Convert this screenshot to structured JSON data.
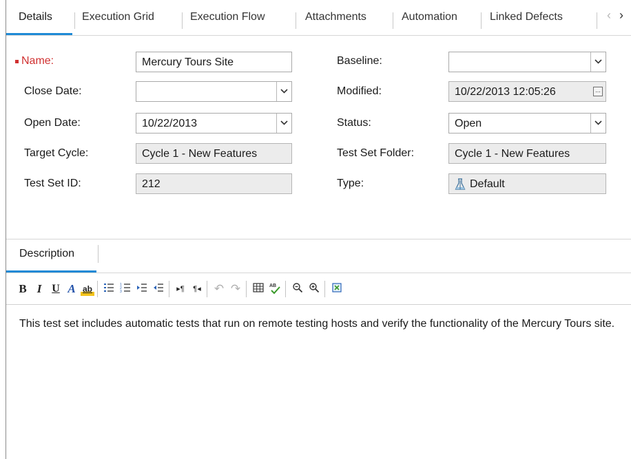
{
  "tabs": {
    "items": [
      "Details",
      "Execution Grid",
      "Execution Flow",
      "Attachments",
      "Automation",
      "Linked Defects"
    ],
    "active": "Details"
  },
  "form": {
    "name_label": "Name:",
    "name_value": "Mercury Tours Site",
    "close_date_label": "Close Date:",
    "close_date_value": "",
    "open_date_label": "Open Date:",
    "open_date_value": "10/22/2013",
    "target_cycle_label": "Target Cycle:",
    "target_cycle_value": "Cycle 1 - New Features",
    "test_set_id_label": "Test Set ID:",
    "test_set_id_value": "212",
    "baseline_label": "Baseline:",
    "baseline_value": "",
    "modified_label": "Modified:",
    "modified_value": "10/22/2013 12:05:26",
    "status_label": "Status:",
    "status_value": "Open",
    "folder_label": "Test Set Folder:",
    "folder_value": "Cycle 1 - New Features",
    "type_label": "Type:",
    "type_value": "Default",
    "type_icon": "flask-icon"
  },
  "description": {
    "tab_label": "Description",
    "text": "This test set includes automatic tests that run on remote testing hosts and verify the functionality of the Mercury Tours site.",
    "toolbar_icons": [
      "bold-icon",
      "italic-icon",
      "underline-icon",
      "font-color-icon",
      "highlight-icon",
      "bullet-list-icon",
      "numbered-list-icon",
      "indent-icon",
      "outdent-icon",
      "ltr-icon",
      "rtl-icon",
      "undo-icon",
      "redo-icon",
      "table-icon",
      "spellcheck-icon",
      "zoom-out-icon",
      "zoom-in-icon",
      "clear-format-icon"
    ]
  },
  "colors": {
    "accent": "#1e8ad6",
    "required": "#d03030",
    "readonly_bg": "#ececec"
  }
}
